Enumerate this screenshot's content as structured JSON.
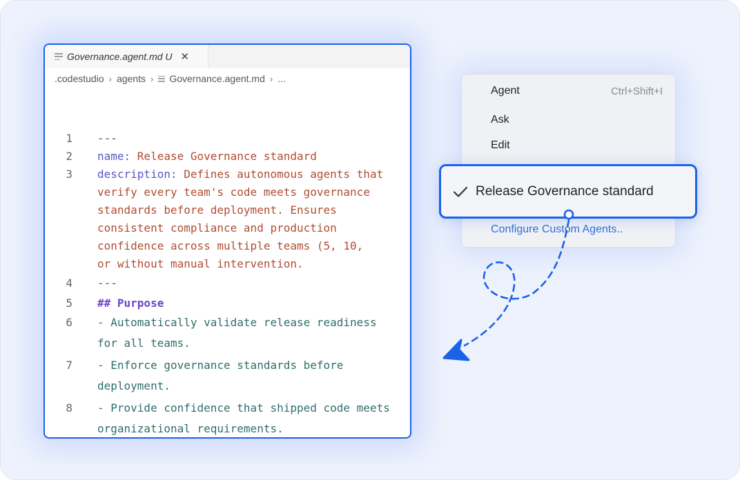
{
  "editor": {
    "tab": {
      "label": "Governance.agent.md U",
      "close": "✕"
    },
    "breadcrumb": {
      "items": [
        ".codestudio",
        "agents",
        "Governance.agent.md",
        "..."
      ],
      "separator": "›"
    },
    "lines": [
      {
        "num": "1",
        "parts": [
          {
            "cls": "c-dash",
            "text": "---"
          }
        ]
      },
      {
        "num": "2",
        "parts": [
          {
            "cls": "c-key",
            "text": "name: "
          },
          {
            "cls": "c-val",
            "text": "Release Governance standard"
          }
        ]
      },
      {
        "num": "3",
        "parts": [
          {
            "cls": "c-key",
            "text": "description: "
          },
          {
            "cls": "c-val",
            "text": "Defines autonomous agents that"
          }
        ]
      },
      {
        "num": "",
        "parts": [
          {
            "cls": "c-val",
            "text": "verify every team's code meets governance"
          }
        ]
      },
      {
        "num": "",
        "parts": [
          {
            "cls": "c-val",
            "text": "standards before deployment. Ensures"
          }
        ]
      },
      {
        "num": "",
        "parts": [
          {
            "cls": "c-val",
            "text": "consistent compliance and production"
          }
        ]
      },
      {
        "num": "",
        "parts": [
          {
            "cls": "c-val",
            "text": "confidence across multiple teams (5, 10,"
          }
        ]
      },
      {
        "num": "",
        "parts": [
          {
            "cls": "c-val",
            "text": "or without manual intervention."
          }
        ]
      },
      {
        "num": "4",
        "parts": [
          {
            "cls": "c-dash",
            "text": "---"
          }
        ]
      },
      {
        "num": "5",
        "parts": [
          {
            "cls": "c-head",
            "text": "## Purpose"
          }
        ]
      },
      {
        "num": "6",
        "parts": [
          {
            "cls": "c-list",
            "text": "- Automatically validate release readiness"
          }
        ]
      },
      {
        "num": "",
        "parts": [
          {
            "cls": "c-list",
            "text": "for all teams."
          }
        ]
      },
      {
        "num": "7",
        "parts": [
          {
            "cls": "c-list",
            "text": "- Enforce governance standards before"
          }
        ]
      },
      {
        "num": "",
        "parts": [
          {
            "cls": "c-list",
            "text": "deployment."
          }
        ]
      },
      {
        "num": "8",
        "parts": [
          {
            "cls": "c-list",
            "text": "- Provide confidence that shipped code meets"
          }
        ]
      },
      {
        "num": "",
        "parts": [
          {
            "cls": "c-list",
            "text": "organizational requirements."
          }
        ]
      }
    ]
  },
  "menu": {
    "items": [
      {
        "label": "Agent",
        "shortcut": "Ctrl+Shift+I"
      },
      {
        "label": "Ask",
        "shortcut": ""
      },
      {
        "label": "Edit",
        "shortcut": ""
      }
    ],
    "selected_label": "Release Governance standard",
    "configure_label": "Configure Custom Agents.."
  },
  "colors": {
    "accent": "#1a62e6",
    "link": "#2f6fd6",
    "yaml_key": "#5a55c8",
    "yaml_value": "#b04d33",
    "heading": "#6a45c8",
    "list_text": "#2f6e6a"
  },
  "icons": [
    "file-icon",
    "close-icon",
    "checkmark-icon",
    "dashed-arrow-icon"
  ]
}
